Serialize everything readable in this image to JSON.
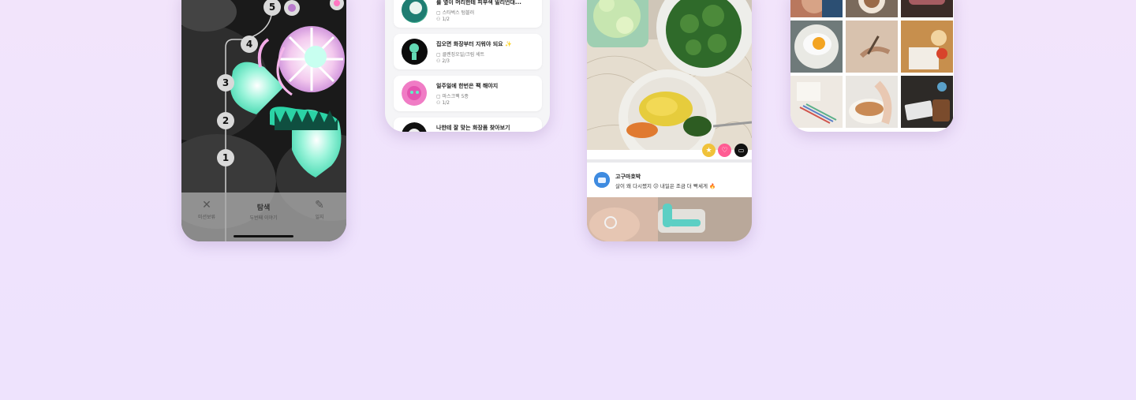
{
  "phone_exploration": {
    "steps": [
      "5",
      "4",
      "3",
      "2",
      "1"
    ],
    "tabs": {
      "left_label": "미션보류",
      "center_title": "탐색",
      "center_sub": "두번째 이야기",
      "right_label": "일지"
    }
  },
  "phone_missions": {
    "items": [
      {
        "title": "를 옆이 머리한테 피부색 밀리언대...",
        "meta1": "스타벅스 텀블러",
        "meta2": "1/2"
      },
      {
        "title": "집오면 화장부터 지워야 되요",
        "meta1": "클렌징오일/크림 세트",
        "meta2": "2/3"
      },
      {
        "title": "일주일에 한번은 팩 해야지",
        "meta1": "마스크팩 5종",
        "meta2": "1/2"
      },
      {
        "title": "나한테 잘 맞는 화장품 찾아보기",
        "meta1": "",
        "meta2": ""
      }
    ]
  },
  "phone_feed": {
    "comment": {
      "author": "고구마호박",
      "text": "살이 왜 다시쪘지 😕 내일은 조금 더 빡세게 🔥"
    }
  },
  "colors": {
    "background": "#efe3fd",
    "mint": "#5fe3c0",
    "pink": "#ff5c93"
  }
}
